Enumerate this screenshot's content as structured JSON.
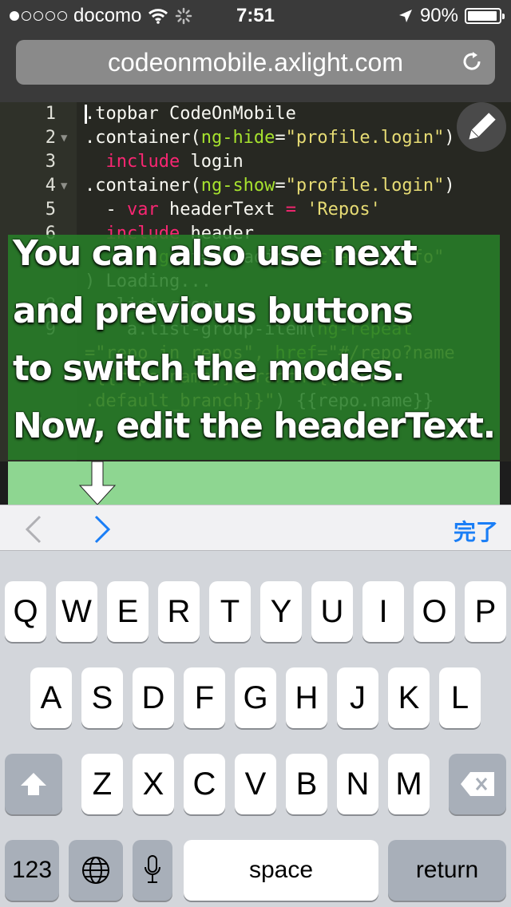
{
  "status_bar": {
    "carrier": "docomo",
    "signal_bars_filled": 1,
    "signal_bars_total": 5,
    "time": "7:51",
    "battery": "90%"
  },
  "url_bar": {
    "url": "codeonmobile.axlight.com"
  },
  "editor": {
    "lines": [
      {
        "n": "1",
        "fold": false,
        "tokens": [
          {
            "t": ".topbar CodeOnMobile",
            "c": "plain"
          }
        ],
        "cursor": true
      },
      {
        "n": "2",
        "fold": true,
        "tokens": [
          {
            "t": ".container(",
            "c": "plain"
          },
          {
            "t": "ng-hide",
            "c": "attr"
          },
          {
            "t": "=",
            "c": "plain"
          },
          {
            "t": "\"profile.login\"",
            "c": "str"
          },
          {
            "t": ")",
            "c": "plain"
          }
        ]
      },
      {
        "n": "3",
        "fold": false,
        "tokens": [
          {
            "t": "  ",
            "c": "plain"
          },
          {
            "t": "include",
            "c": "kw"
          },
          {
            "t": " login",
            "c": "plain"
          }
        ]
      },
      {
        "n": "4",
        "fold": true,
        "tokens": [
          {
            "t": ".container(",
            "c": "plain"
          },
          {
            "t": "ng-show",
            "c": "attr"
          },
          {
            "t": "=",
            "c": "plain"
          },
          {
            "t": "\"profile.login\"",
            "c": "str"
          },
          {
            "t": ")",
            "c": "plain"
          }
        ]
      },
      {
        "n": "5",
        "fold": false,
        "tokens": [
          {
            "t": "  - ",
            "c": "plain"
          },
          {
            "t": "var",
            "c": "kw"
          },
          {
            "t": " headerText ",
            "c": "plain"
          },
          {
            "t": "=",
            "c": "kw"
          },
          {
            "t": " ",
            "c": "plain"
          },
          {
            "t": "'Repos'",
            "c": "str"
          }
        ]
      },
      {
        "n": "6",
        "fold": false,
        "tokens": [
          {
            "t": "  ",
            "c": "plain"
          },
          {
            "t": "include",
            "c": "kw"
          },
          {
            "t": " header",
            "c": "plain"
          }
        ]
      },
      {
        "n": "",
        "fold": false,
        "tokens": [
          {
            "t": "    .(",
            "c": "plain"
          },
          {
            "t": "ng-",
            "c": "attr"
          },
          {
            "t": "if=\"loading\" ",
            "c": "plain"
          },
          {
            "t": "class",
            "c": "attr"
          },
          {
            "t": "=",
            "c": "plain"
          },
          {
            "t": "\"info\"",
            "c": "str"
          }
        ]
      },
      {
        "n": "",
        "fold": false,
        "tokens": [
          {
            "t": ") Loading...",
            "c": "plain"
          }
        ]
      },
      {
        "n": "8",
        "fold": true,
        "tokens": [
          {
            "t": "  .list-group",
            "c": "plain"
          }
        ]
      },
      {
        "n": "9",
        "fold": false,
        "tokens": [
          {
            "t": "    a.list-group-item(",
            "c": "plain"
          },
          {
            "t": "ng-repeat",
            "c": "attr"
          }
        ]
      },
      {
        "n": "",
        "fold": false,
        "tokens": [
          {
            "t": "=\"repo in repos\", ",
            "c": "str"
          },
          {
            "t": "href",
            "c": "attr"
          },
          {
            "t": "=\"#/repo?name",
            "c": "str"
          }
        ]
      },
      {
        "n": "",
        "fold": false,
        "tokens": [
          {
            "t": "={{repo.name}}&branch={{repo",
            "c": "str"
          }
        ]
      },
      {
        "n": "",
        "fold": false,
        "tokens": [
          {
            "t": ".default_branch}}\"",
            "c": "str"
          },
          {
            "t": ") {{repo.name}}",
            "c": "plain"
          }
        ]
      },
      {
        "n": "10",
        "fold": false,
        "tokens": [
          {
            "t": "",
            "c": "plain"
          }
        ]
      }
    ]
  },
  "overlay": {
    "lines": [
      "You can also use next",
      "and previous buttons",
      "to switch the modes.",
      "Now, edit the headerText."
    ]
  },
  "accessory_bar": {
    "done_label": "完了"
  },
  "keyboard": {
    "row1": [
      "Q",
      "W",
      "E",
      "R",
      "T",
      "Y",
      "U",
      "I",
      "O",
      "P"
    ],
    "row2": [
      "A",
      "S",
      "D",
      "F",
      "G",
      "H",
      "J",
      "K",
      "L"
    ],
    "row3": [
      "Z",
      "X",
      "C",
      "V",
      "B",
      "N",
      "M"
    ],
    "numbers_label": "123",
    "space_label": "space",
    "return_label": "return"
  },
  "icons": {
    "reload": "reload-icon",
    "pencil": "pencil-icon",
    "shift": "shift-icon",
    "backspace": "backspace-icon",
    "globe": "globe-icon",
    "mic": "microphone-icon",
    "location": "location-arrow-icon",
    "wifi": "wifi-icon"
  },
  "colors": {
    "editor_bg": "#272822",
    "string": "#e6db74",
    "attribute": "#a6e22e",
    "keyword": "#f92672",
    "overlay": "#287d28",
    "accent": "#1a7ef6"
  }
}
